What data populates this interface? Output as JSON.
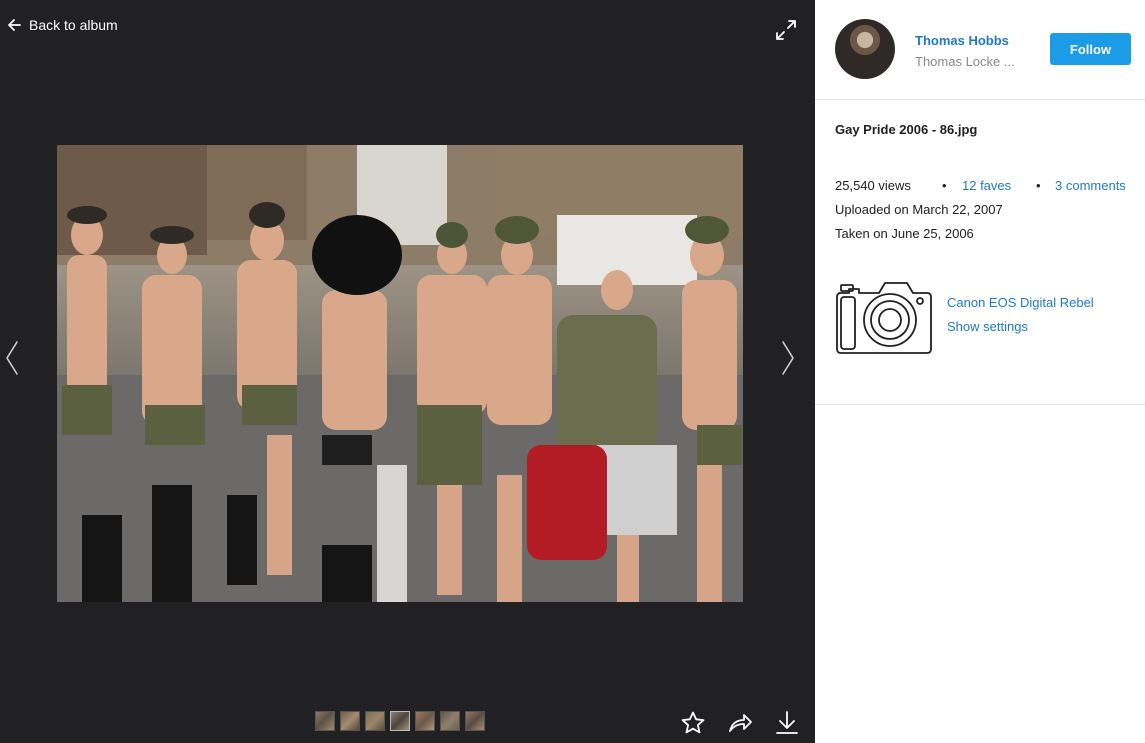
{
  "viewer": {
    "back_label": "Back to album",
    "photo_alt": "Gay Pride 2006 - 86.jpg",
    "thumbnail_count": 7
  },
  "owner": {
    "name": "Thomas Hobbs",
    "real_name": "Thomas Locke ...",
    "follow_label": "Follow"
  },
  "photo_info": {
    "title": "Gay Pride 2006 - 86.jpg",
    "views": "25,540 views",
    "faves": "12 faves",
    "comments": "3 comments",
    "separator": "•",
    "uploaded": "Uploaded on March 22, 2007",
    "taken": "Taken on June 25, 2006"
  },
  "camera": {
    "model": "Canon EOS Digital Rebel",
    "settings_label": "Show settings"
  },
  "colors": {
    "viewer_bg": "#212124",
    "link": "#1f79c8",
    "follow_button": "#1c9be6"
  },
  "icons": {
    "back": "arrow-left-icon",
    "expand": "expand-icon",
    "prev": "chevron-left-icon",
    "next": "chevron-right-icon",
    "fave": "star-icon",
    "share": "share-icon",
    "download": "download-icon",
    "camera": "camera-icon"
  }
}
